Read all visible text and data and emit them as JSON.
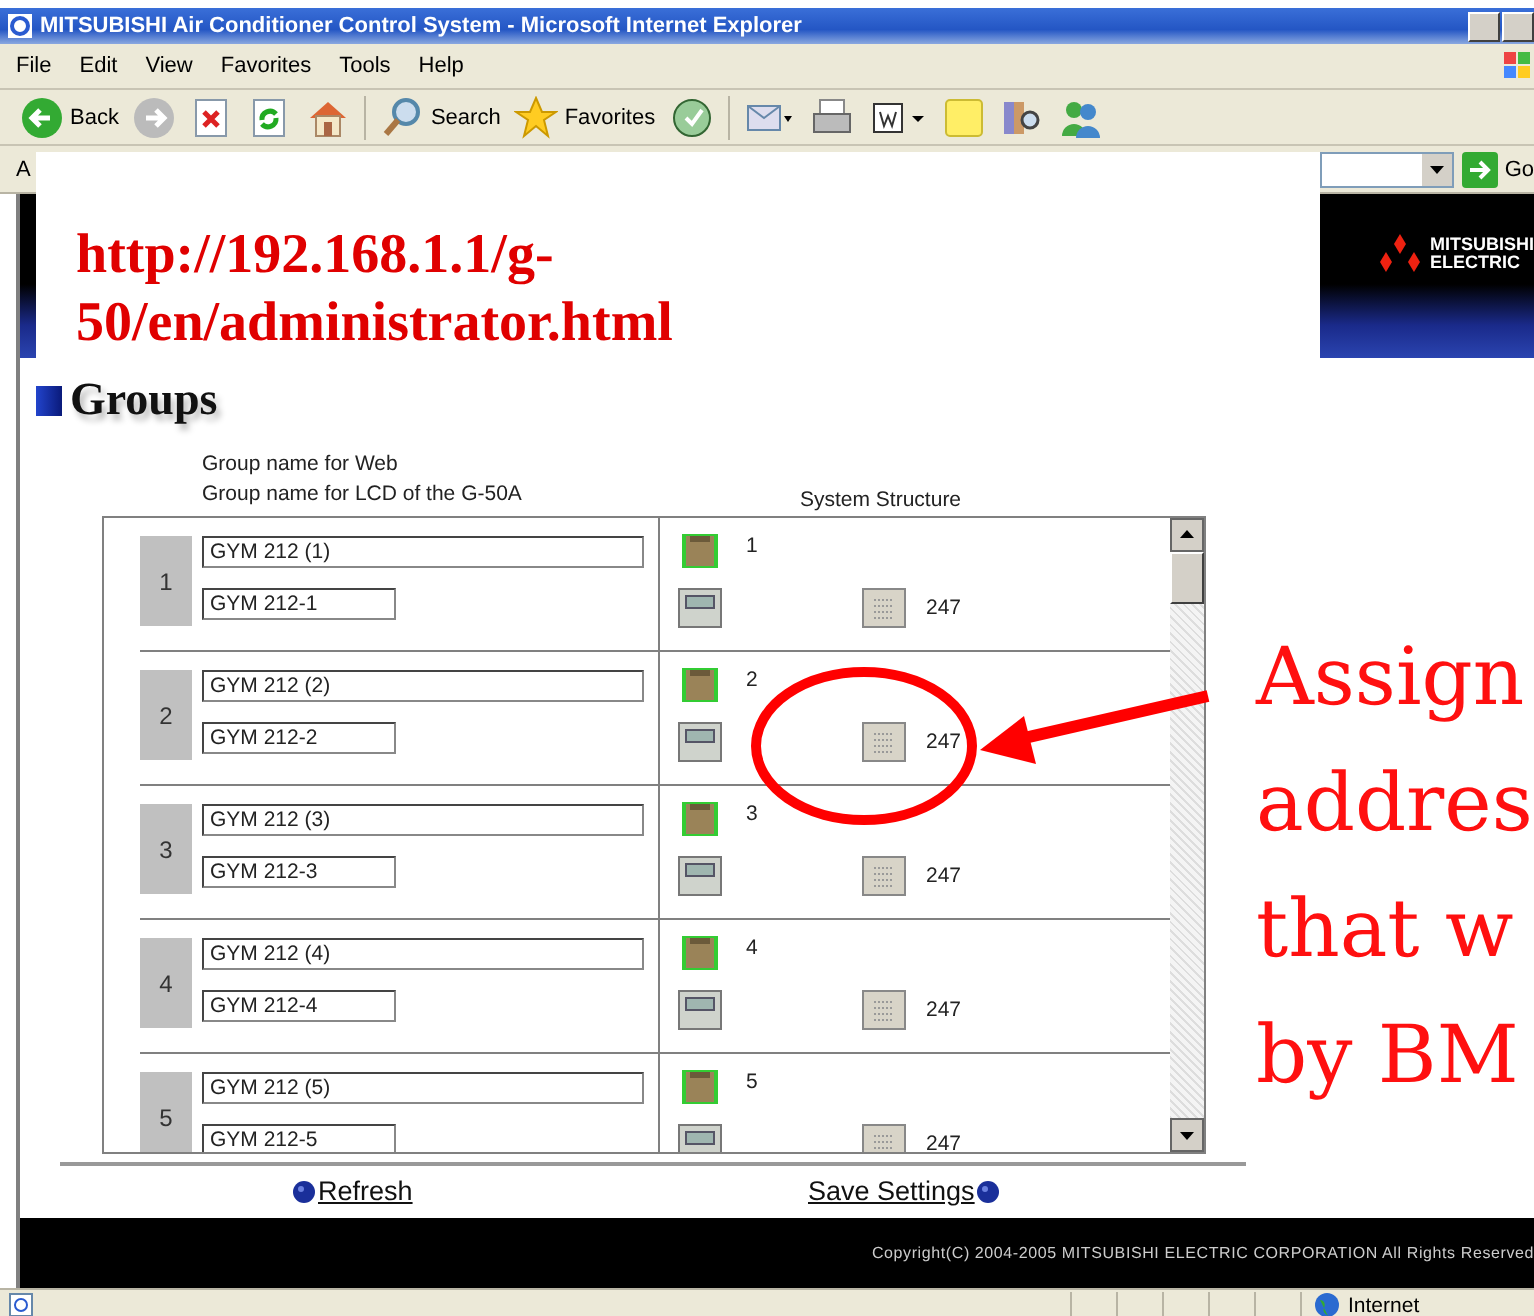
{
  "window": {
    "title": "MITSUBISHI Air Conditioner Control System - Microsoft Internet Explorer"
  },
  "menu": [
    "File",
    "Edit",
    "View",
    "Favorites",
    "Tools",
    "Help"
  ],
  "toolbar": [
    {
      "kind": "back",
      "label": "Back"
    },
    {
      "kind": "forward"
    },
    {
      "kind": "stop"
    },
    {
      "kind": "refresh"
    },
    {
      "kind": "home"
    },
    {
      "kind": "search",
      "label": "Search"
    },
    {
      "kind": "favorites",
      "label": "Favorites"
    },
    {
      "kind": "media"
    },
    {
      "kind": "mail"
    },
    {
      "kind": "print"
    },
    {
      "kind": "edit"
    },
    {
      "kind": "notes"
    },
    {
      "kind": "research"
    },
    {
      "kind": "messenger"
    }
  ],
  "address_bar": {
    "label": "A",
    "go": "Go"
  },
  "page": {
    "brand": [
      "MITSUBISHI",
      "ELECTRIC"
    ],
    "heading": "Groups",
    "column_labels": [
      "Group name for Web",
      "Group name for LCD of the G-50A"
    ],
    "structure_label": "System Structure",
    "groups": [
      {
        "number": "1",
        "web_name": "GYM 212 (1)",
        "lcd_name": "GYM 212-1",
        "unit": "1",
        "controller": "247"
      },
      {
        "number": "2",
        "web_name": "GYM 212 (2)",
        "lcd_name": "GYM 212-2",
        "unit": "2",
        "controller": "247"
      },
      {
        "number": "3",
        "web_name": "GYM 212 (3)",
        "lcd_name": "GYM 212-3",
        "unit": "3",
        "controller": "247"
      },
      {
        "number": "4",
        "web_name": "GYM 212 (4)",
        "lcd_name": "GYM 212-4",
        "unit": "4",
        "controller": "247"
      },
      {
        "number": "5",
        "web_name": "GYM 212 (5)",
        "lcd_name": "GYM 212-5",
        "unit": "5",
        "controller": "247"
      }
    ],
    "actions": [
      "Refresh",
      "Save Settings"
    ],
    "copyright": "Copyright(C) 2004-2005 MITSUBISHI ELECTRIC CORPORATION All Rights Reserved"
  },
  "status_bar": {
    "zone": "Internet"
  },
  "annotations": {
    "url_lines": [
      "http://192.168.1.1/g-",
      "50/en/administrator.html"
    ],
    "note_lines": [
      "Assign",
      "addres",
      "that w",
      "by BM"
    ]
  }
}
